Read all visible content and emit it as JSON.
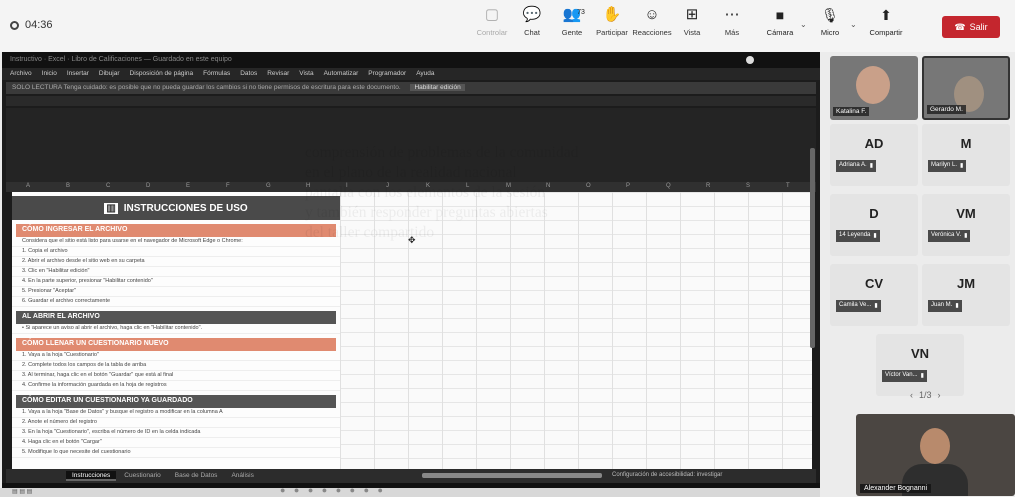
{
  "meeting": {
    "timer": "04:36",
    "tools": [
      {
        "icon": "share-screen-icon",
        "glyph": "▢",
        "label": "Controlar",
        "dim": true
      },
      {
        "icon": "chat-icon",
        "glyph": "💬",
        "label": "Chat",
        "dim": false
      },
      {
        "icon": "people-icon",
        "glyph": "👥",
        "label": "Gente",
        "dim": false
      },
      {
        "icon": "raise-hand-icon",
        "glyph": "✋",
        "label": "Participar",
        "dim": false
      },
      {
        "icon": "reactions-icon",
        "glyph": "☺",
        "label": "Reacciones",
        "dim": false
      },
      {
        "icon": "view-icon",
        "glyph": "⊞",
        "label": "Vista",
        "dim": false
      },
      {
        "icon": "more-icon",
        "glyph": "⋯",
        "label": "Más",
        "dim": false
      }
    ],
    "people_count": "73",
    "camera_label": "Cámara",
    "mic_label": "Micro",
    "share_label": "Compartir",
    "leave_label": "Salir"
  },
  "shared": {
    "window_title": "Instructivo · Excel · Libro de Calificaciones — Guardado en este equipo",
    "menu": [
      "Archivo",
      "Inicio",
      "Insertar",
      "Dibujar",
      "Disposición de página",
      "Fórmulas",
      "Datos",
      "Revisar",
      "Vista",
      "Automatizar",
      "Programador",
      "Ayuda"
    ],
    "notice": "SOLO LECTURA  Tenga cuidado: es posible que no pueda guardar los cambios si no tiene permisos de escritura para este documento.",
    "notice_button": "Habilitar edición",
    "col_letters": [
      "A",
      "B",
      "C",
      "D",
      "E",
      "F",
      "G",
      "H",
      "I",
      "J",
      "K",
      "L",
      "M",
      "N",
      "O",
      "P",
      "Q",
      "R",
      "S",
      "T"
    ],
    "instructions_title": "INSTRUCCIONES DE USO",
    "sections": [
      {
        "title": "CÓMO INGRESAR EL ARCHIVO",
        "tone": "or",
        "lines": [
          "Considera que el sitio está listo para usarse en el navegador de Microsoft Edge o Chrome:",
          "1. Copia el archivo",
          "2. Abrir el archivo desde el sitio web en su carpeta",
          "3. Clic en \"Habilitar edición\"",
          "4. En la parte superior, presionar \"Habilitar contenido\"",
          "5. Presionar \"Aceptar\"",
          "6. Guardar el archivo correctamente"
        ]
      },
      {
        "title": "AL ABRIR EL ARCHIVO",
        "tone": "dk",
        "lines": [
          "• Si aparece un aviso al abrir el archivo, haga clic en \"Habilitar contenido\"."
        ]
      },
      {
        "title": "CÓMO LLENAR UN CUESTIONARIO NUEVO",
        "tone": "or",
        "lines": [
          "1. Vaya a la hoja \"Cuestionario\"",
          "2. Complete todos los campos de la tabla de arriba",
          "3. Al terminar, haga clic en el botón \"Guardar\" que está al final",
          "4. Confirme la información guardada en la hoja de registros"
        ]
      },
      {
        "title": "CÓMO EDITAR UN CUESTIONARIO YA GUARDADO",
        "tone": "dk",
        "lines": [
          "1. Vaya a la hoja \"Base de Datos\" y busque el registro a modificar en la columna A",
          "2. Anote el número del registro",
          "3. En la hoja \"Cuestionario\", escriba el número de ID en la celda indicada",
          "4. Haga clic en el botón \"Cargar\"",
          "5. Modifique lo que necesite del cuestionario"
        ]
      }
    ],
    "sheet_tabs": [
      "Instrucciones",
      "Cuestionario",
      "Base de Datos",
      "Análisis"
    ],
    "zoom": "Configuración de accesibilidad: investigar"
  },
  "caption": [
    "comprensión de problemas de la comunidad",
    "en el plano de la realidad nacional",
    "pantalla con los elementos de la sesión",
    "y también responder preguntas abiertas",
    "del taller compartido"
  ],
  "participants": {
    "video": [
      {
        "name": "Katalina F.",
        "tone": "#8a6a55"
      },
      {
        "name": "Gerardo M.",
        "tone": "#6b7a85"
      }
    ],
    "tiles": [
      {
        "initials": "AD",
        "name": "Adriana A."
      },
      {
        "initials": "M",
        "name": "Marilyn L."
      },
      {
        "initials": "D",
        "name": "14 Leyenda"
      },
      {
        "initials": "VM",
        "name": "Verónica V."
      },
      {
        "initials": "CV",
        "name": "Camila Ve..."
      },
      {
        "initials": "JM",
        "name": "Juan M."
      },
      {
        "initials": "VN",
        "name": "Víctor Van..."
      }
    ],
    "pager": "1/3",
    "self": {
      "name": "Alexander Bognanni"
    }
  }
}
